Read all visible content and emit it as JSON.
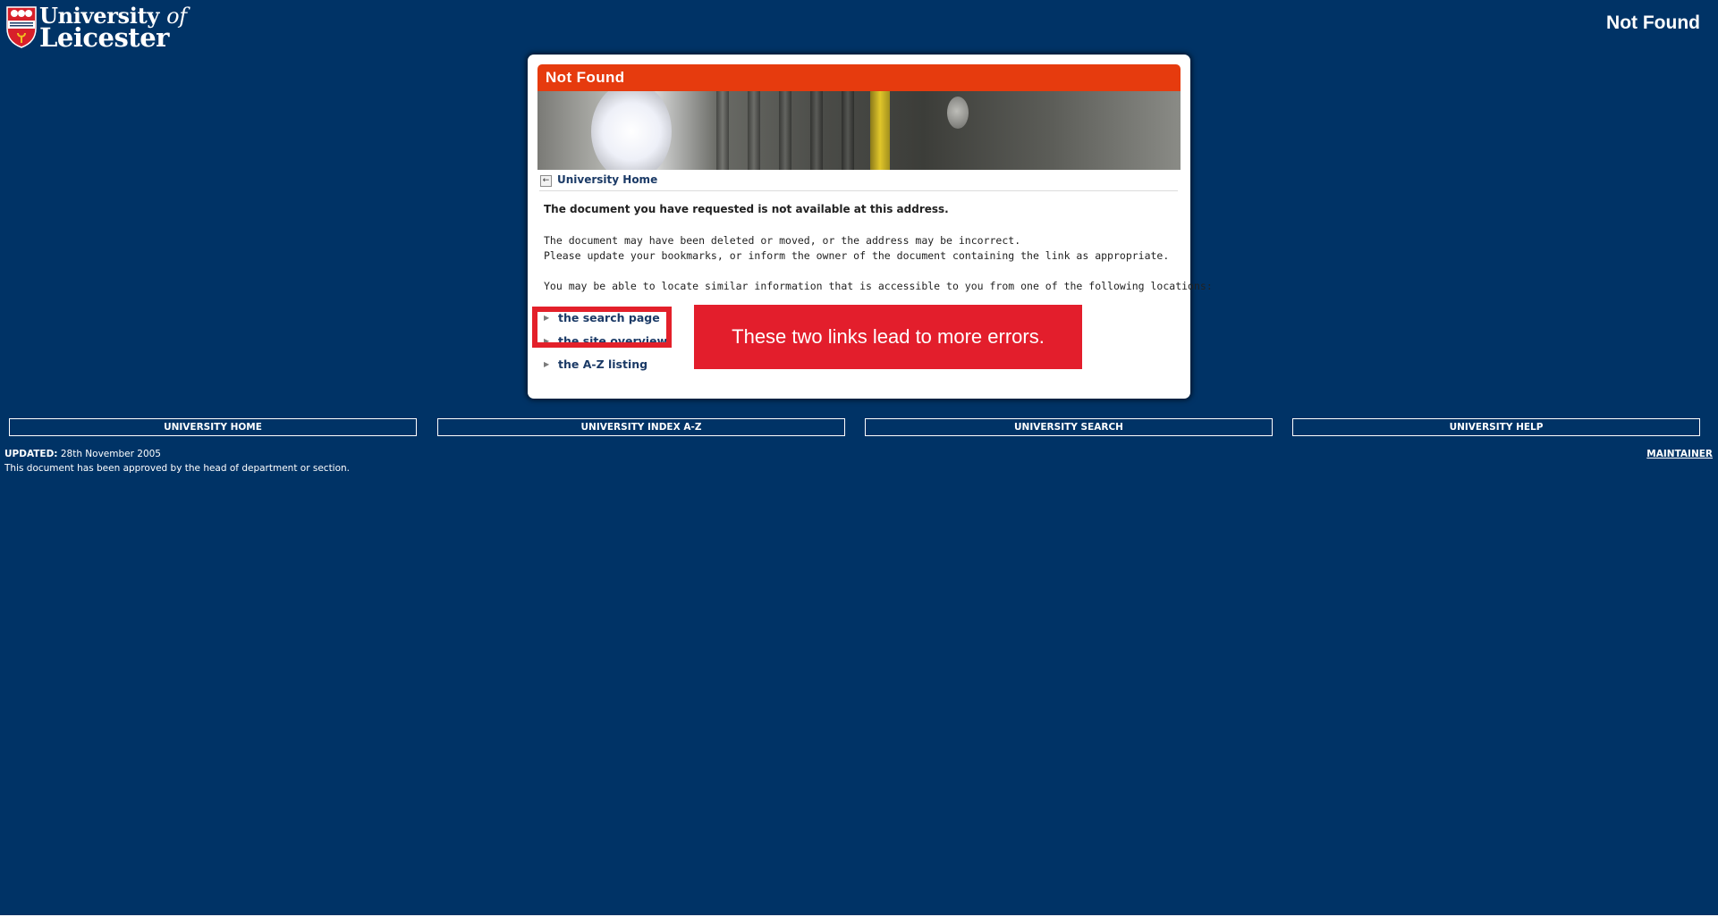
{
  "header": {
    "logo": {
      "line1": "University",
      "line1_of": "of",
      "line2": "Leicester",
      "crest_text": "UNIVERSITY OF LEICESTER"
    },
    "page_title": "Not Found"
  },
  "panel": {
    "title": "Not Found",
    "breadcrumb": {
      "icon": "back-arrow-icon",
      "label": "University Home"
    },
    "messages": {
      "heading": "The document you have requested is not available at this address.",
      "line1": "The document may have been deleted or moved, or the address may be incorrect.",
      "line2": "Please update your bookmarks, or inform the owner of the document containing the link as appropriate.",
      "line3": "You may be able to locate similar information that is accessible to you from one of the following locations:"
    },
    "links": [
      {
        "label": "the search page",
        "icon": "arrow-right-icon"
      },
      {
        "label": "the site overview",
        "icon": "arrow-right-icon"
      },
      {
        "label": "the A-Z listing",
        "icon": "arrow-right-icon"
      }
    ],
    "annotation": {
      "text": "These two links lead to more errors.",
      "color": "#e31e2c"
    }
  },
  "footer": {
    "nav": [
      "UNIVERSITY HOME",
      "UNIVERSITY INDEX A-Z",
      "UNIVERSITY SEARCH",
      "UNIVERSITY HELP"
    ],
    "updated_label": "UPDATED:",
    "updated_value": " 28th November 2005",
    "approval": "This document has been approved by the head of department or section.",
    "maintainer": "MAINTAINER"
  },
  "colors": {
    "background": "#003366",
    "title_bar": "#e63b0e",
    "link": "#1b3a66",
    "highlight": "#e3202a"
  }
}
